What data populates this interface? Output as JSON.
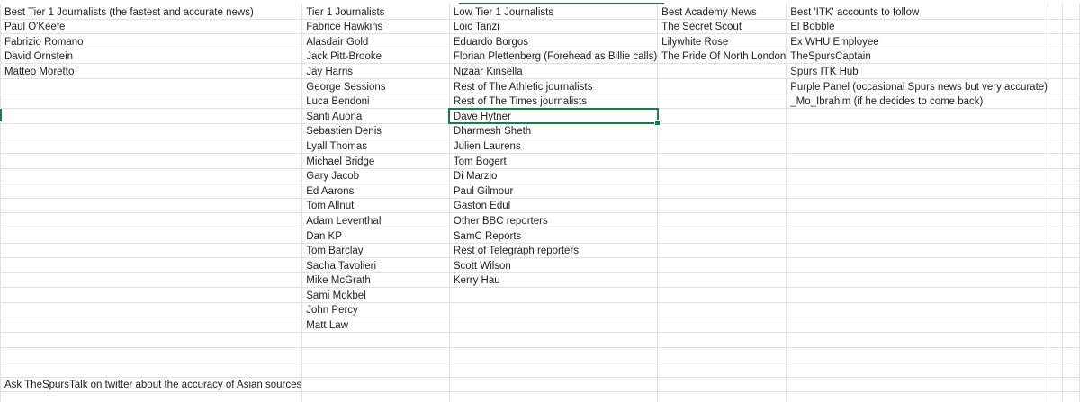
{
  "sheet": {
    "rows": [
      [
        "Best Tier 1 Journalists (the fastest and accurate news)",
        "Tier 1 Journalists",
        "Low Tier 1 Journalists",
        "Best Academy News",
        "Best 'ITK' accounts to follow",
        "",
        ""
      ],
      [
        "Paul O'Keefe",
        "Fabrice Hawkins",
        "Loic Tanzi",
        "The Secret Scout",
        "El Bobble",
        "",
        ""
      ],
      [
        "Fabrizio Romano",
        "Alasdair Gold",
        "Eduardo Borgos",
        "Lilywhite Rose",
        "Ex WHU Employee",
        "",
        ""
      ],
      [
        "David Ornstein",
        "Jack Pitt-Brooke",
        "Florian Plettenberg (Forehead as Billie calls)",
        "The Pride Of North London",
        "TheSpursCaptain",
        "",
        ""
      ],
      [
        "Matteo Moretto",
        "Jay Harris",
        "Nizaar Kinsella",
        "",
        "Spurs ITK Hub",
        "",
        ""
      ],
      [
        "",
        "George Sessions",
        "Rest of The Athletic journalists",
        "",
        "Purple Panel (occasional Spurs news but very accurate)",
        "",
        ""
      ],
      [
        "",
        "Luca Bendoni",
        "Rest of The Times journalists",
        "",
        "_Mo_Ibrahim (if he decides to come back)",
        "",
        ""
      ],
      [
        "",
        "Santi Auona",
        "Dave Hytner",
        "",
        "",
        "",
        ""
      ],
      [
        "",
        "Sebastien Denis",
        "Dharmesh Sheth",
        "",
        "",
        "",
        ""
      ],
      [
        "",
        "Lyall Thomas",
        "Julien Laurens",
        "",
        "",
        "",
        ""
      ],
      [
        "",
        "Michael Bridge",
        "Tom Bogert",
        "",
        "",
        "",
        ""
      ],
      [
        "",
        "Gary Jacob",
        "Di Marzio",
        "",
        "",
        "",
        ""
      ],
      [
        "",
        "Ed Aarons",
        "Paul Gilmour",
        "",
        "",
        "",
        ""
      ],
      [
        "",
        "Tom Allnut",
        "Gaston Edul",
        "",
        "",
        "",
        ""
      ],
      [
        "",
        "Adam Leventhal",
        "Other BBC reporters",
        "",
        "",
        "",
        ""
      ],
      [
        "",
        "Dan KP",
        "SamC Reports",
        "",
        "",
        "",
        ""
      ],
      [
        "",
        "Tom Barclay",
        "Rest of Telegraph reporters",
        "",
        "",
        "",
        ""
      ],
      [
        "",
        "Sacha Tavolieri",
        "Scott Wilson",
        "",
        "",
        "",
        ""
      ],
      [
        "",
        "Mike McGrath",
        "Kerry Hau",
        "",
        "",
        "",
        ""
      ],
      [
        "",
        "Sami Mokbel",
        "",
        "",
        "",
        "",
        ""
      ],
      [
        "",
        "John Percy",
        "",
        "",
        "",
        "",
        ""
      ],
      [
        "",
        "Matt Law",
        "",
        "",
        "",
        "",
        ""
      ],
      [
        "",
        "",
        "",
        "",
        "",
        "",
        ""
      ],
      [
        "",
        "",
        "",
        "",
        "",
        "",
        ""
      ],
      [
        "",
        "",
        "",
        "",
        "",
        "",
        ""
      ],
      [
        "Ask TheSpursTalk on twitter about the accuracy of Asian sources",
        "",
        "",
        "",
        "",
        "",
        ""
      ],
      [
        "",
        "",
        "",
        "",
        "",
        "",
        ""
      ]
    ],
    "accent_color": "#1d7a45"
  }
}
